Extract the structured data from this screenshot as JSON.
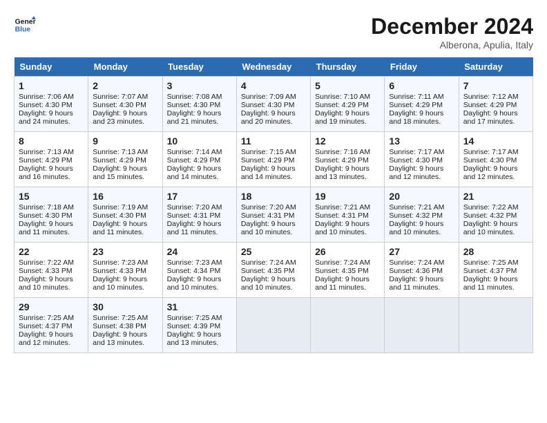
{
  "header": {
    "logo_line1": "General",
    "logo_line2": "Blue",
    "month": "December 2024",
    "location": "Alberona, Apulia, Italy"
  },
  "days_of_week": [
    "Sunday",
    "Monday",
    "Tuesday",
    "Wednesday",
    "Thursday",
    "Friday",
    "Saturday"
  ],
  "weeks": [
    [
      {
        "day": "1",
        "sunrise": "Sunrise: 7:06 AM",
        "sunset": "Sunset: 4:30 PM",
        "daylight": "Daylight: 9 hours and 24 minutes."
      },
      {
        "day": "2",
        "sunrise": "Sunrise: 7:07 AM",
        "sunset": "Sunset: 4:30 PM",
        "daylight": "Daylight: 9 hours and 23 minutes."
      },
      {
        "day": "3",
        "sunrise": "Sunrise: 7:08 AM",
        "sunset": "Sunset: 4:30 PM",
        "daylight": "Daylight: 9 hours and 21 minutes."
      },
      {
        "day": "4",
        "sunrise": "Sunrise: 7:09 AM",
        "sunset": "Sunset: 4:30 PM",
        "daylight": "Daylight: 9 hours and 20 minutes."
      },
      {
        "day": "5",
        "sunrise": "Sunrise: 7:10 AM",
        "sunset": "Sunset: 4:29 PM",
        "daylight": "Daylight: 9 hours and 19 minutes."
      },
      {
        "day": "6",
        "sunrise": "Sunrise: 7:11 AM",
        "sunset": "Sunset: 4:29 PM",
        "daylight": "Daylight: 9 hours and 18 minutes."
      },
      {
        "day": "7",
        "sunrise": "Sunrise: 7:12 AM",
        "sunset": "Sunset: 4:29 PM",
        "daylight": "Daylight: 9 hours and 17 minutes."
      }
    ],
    [
      {
        "day": "8",
        "sunrise": "Sunrise: 7:13 AM",
        "sunset": "Sunset: 4:29 PM",
        "daylight": "Daylight: 9 hours and 16 minutes."
      },
      {
        "day": "9",
        "sunrise": "Sunrise: 7:13 AM",
        "sunset": "Sunset: 4:29 PM",
        "daylight": "Daylight: 9 hours and 15 minutes."
      },
      {
        "day": "10",
        "sunrise": "Sunrise: 7:14 AM",
        "sunset": "Sunset: 4:29 PM",
        "daylight": "Daylight: 9 hours and 14 minutes."
      },
      {
        "day": "11",
        "sunrise": "Sunrise: 7:15 AM",
        "sunset": "Sunset: 4:29 PM",
        "daylight": "Daylight: 9 hours and 14 minutes."
      },
      {
        "day": "12",
        "sunrise": "Sunrise: 7:16 AM",
        "sunset": "Sunset: 4:29 PM",
        "daylight": "Daylight: 9 hours and 13 minutes."
      },
      {
        "day": "13",
        "sunrise": "Sunrise: 7:17 AM",
        "sunset": "Sunset: 4:30 PM",
        "daylight": "Daylight: 9 hours and 12 minutes."
      },
      {
        "day": "14",
        "sunrise": "Sunrise: 7:17 AM",
        "sunset": "Sunset: 4:30 PM",
        "daylight": "Daylight: 9 hours and 12 minutes."
      }
    ],
    [
      {
        "day": "15",
        "sunrise": "Sunrise: 7:18 AM",
        "sunset": "Sunset: 4:30 PM",
        "daylight": "Daylight: 9 hours and 11 minutes."
      },
      {
        "day": "16",
        "sunrise": "Sunrise: 7:19 AM",
        "sunset": "Sunset: 4:30 PM",
        "daylight": "Daylight: 9 hours and 11 minutes."
      },
      {
        "day": "17",
        "sunrise": "Sunrise: 7:20 AM",
        "sunset": "Sunset: 4:31 PM",
        "daylight": "Daylight: 9 hours and 11 minutes."
      },
      {
        "day": "18",
        "sunrise": "Sunrise: 7:20 AM",
        "sunset": "Sunset: 4:31 PM",
        "daylight": "Daylight: 9 hours and 10 minutes."
      },
      {
        "day": "19",
        "sunrise": "Sunrise: 7:21 AM",
        "sunset": "Sunset: 4:31 PM",
        "daylight": "Daylight: 9 hours and 10 minutes."
      },
      {
        "day": "20",
        "sunrise": "Sunrise: 7:21 AM",
        "sunset": "Sunset: 4:32 PM",
        "daylight": "Daylight: 9 hours and 10 minutes."
      },
      {
        "day": "21",
        "sunrise": "Sunrise: 7:22 AM",
        "sunset": "Sunset: 4:32 PM",
        "daylight": "Daylight: 9 hours and 10 minutes."
      }
    ],
    [
      {
        "day": "22",
        "sunrise": "Sunrise: 7:22 AM",
        "sunset": "Sunset: 4:33 PM",
        "daylight": "Daylight: 9 hours and 10 minutes."
      },
      {
        "day": "23",
        "sunrise": "Sunrise: 7:23 AM",
        "sunset": "Sunset: 4:33 PM",
        "daylight": "Daylight: 9 hours and 10 minutes."
      },
      {
        "day": "24",
        "sunrise": "Sunrise: 7:23 AM",
        "sunset": "Sunset: 4:34 PM",
        "daylight": "Daylight: 9 hours and 10 minutes."
      },
      {
        "day": "25",
        "sunrise": "Sunrise: 7:24 AM",
        "sunset": "Sunset: 4:35 PM",
        "daylight": "Daylight: 9 hours and 10 minutes."
      },
      {
        "day": "26",
        "sunrise": "Sunrise: 7:24 AM",
        "sunset": "Sunset: 4:35 PM",
        "daylight": "Daylight: 9 hours and 11 minutes."
      },
      {
        "day": "27",
        "sunrise": "Sunrise: 7:24 AM",
        "sunset": "Sunset: 4:36 PM",
        "daylight": "Daylight: 9 hours and 11 minutes."
      },
      {
        "day": "28",
        "sunrise": "Sunrise: 7:25 AM",
        "sunset": "Sunset: 4:37 PM",
        "daylight": "Daylight: 9 hours and 11 minutes."
      }
    ],
    [
      {
        "day": "29",
        "sunrise": "Sunrise: 7:25 AM",
        "sunset": "Sunset: 4:37 PM",
        "daylight": "Daylight: 9 hours and 12 minutes."
      },
      {
        "day": "30",
        "sunrise": "Sunrise: 7:25 AM",
        "sunset": "Sunset: 4:38 PM",
        "daylight": "Daylight: 9 hours and 13 minutes."
      },
      {
        "day": "31",
        "sunrise": "Sunrise: 7:25 AM",
        "sunset": "Sunset: 4:39 PM",
        "daylight": "Daylight: 9 hours and 13 minutes."
      },
      null,
      null,
      null,
      null
    ]
  ]
}
